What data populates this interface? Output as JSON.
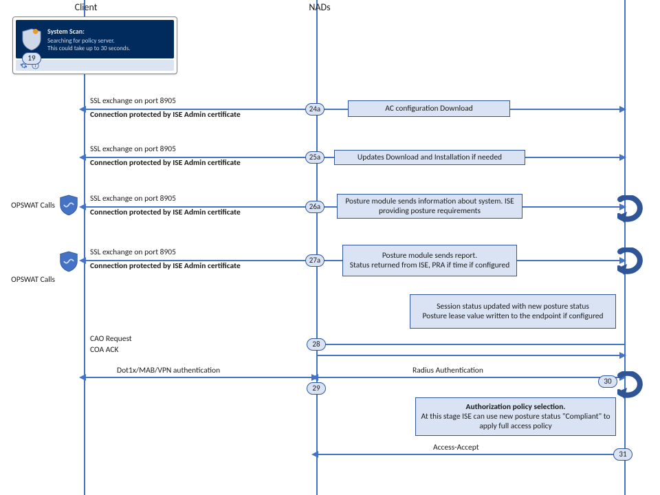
{
  "headers": {
    "client": "Client",
    "nads": "NADs"
  },
  "widget": {
    "title": "System Scan:",
    "line1": "Searching for policy server.",
    "line2": "This could take up to 30 seconds."
  },
  "opswat_label": "OPSWAT Calls",
  "ssl_line1": "SSL exchange on port 8905",
  "ssl_line2": "Connection  protected by ISE Admin certificate",
  "steps": {
    "s19": "19",
    "s24a": "24a",
    "s25a": "25a",
    "s26a": "26a",
    "s27a": "27a",
    "s28": "28",
    "s29": "29",
    "s30": "30",
    "s31": "31"
  },
  "boxes": {
    "b24": "AC configuration Download",
    "b25": "Updates Download and Installation if needed",
    "b26": "Posture module sends information about system. ISE providing posture requirements",
    "b27": "Posture module sends report.\nStatus returned from ISE, PRA if time if configured",
    "session": "Session status updated with new posture status\nPosture lease value written to the endpoint if configured",
    "auth_title": "Authorization policy selection.",
    "auth_body": "At this stage ISE can use new posture status \"Compliant\" to apply full access policy"
  },
  "arrows": {
    "cao_req": "CAO Request",
    "cao_ack": "COA ACK",
    "dot1x": "Dot1x/MAB/VPN  authentication",
    "radius": "Radius Authentication",
    "accept": "Access-Accept"
  }
}
